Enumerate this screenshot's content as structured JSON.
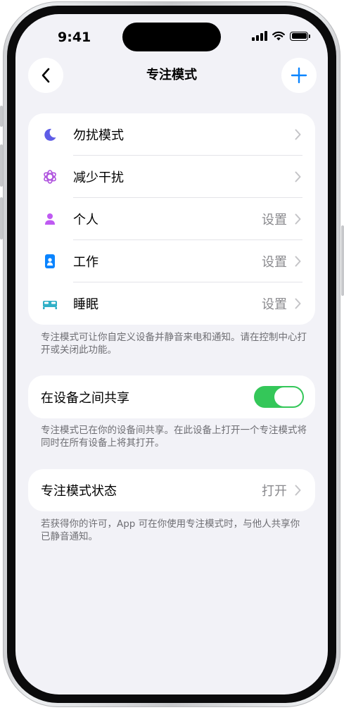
{
  "status_bar": {
    "time": "9:41"
  },
  "nav": {
    "title": "专注模式"
  },
  "focus_modes": [
    {
      "label": "勿扰模式",
      "value": "",
      "icon": "moon-icon",
      "color": "#5e5ce6"
    },
    {
      "label": "减少干扰",
      "value": "",
      "icon": "flower-icon",
      "color": "#af52de"
    },
    {
      "label": "个人",
      "value": "设置",
      "icon": "person-icon",
      "color": "#bf5af2"
    },
    {
      "label": "工作",
      "value": "设置",
      "icon": "id-badge-icon",
      "color": "#0a84ff"
    },
    {
      "label": "睡眠",
      "value": "设置",
      "icon": "bed-icon",
      "color": "#30b0c7"
    }
  ],
  "focus_footnote": "专注模式可让你自定义设备并静音来电和通知。请在控制中心打开或关闭此功能。",
  "share": {
    "label": "在设备之间共享",
    "enabled": true
  },
  "share_footnote": "专注模式已在你的设备间共享。在此设备上打开一个专注模式将同时在所有设备上将其打开。",
  "status": {
    "label": "专注模式状态",
    "value": "打开"
  },
  "status_footnote": "若获得你的许可，App 可在你使用专注模式时，与他人共享你已静音通知。",
  "colors": {
    "accent": "#0a84ff",
    "toggle_on": "#34c759"
  }
}
